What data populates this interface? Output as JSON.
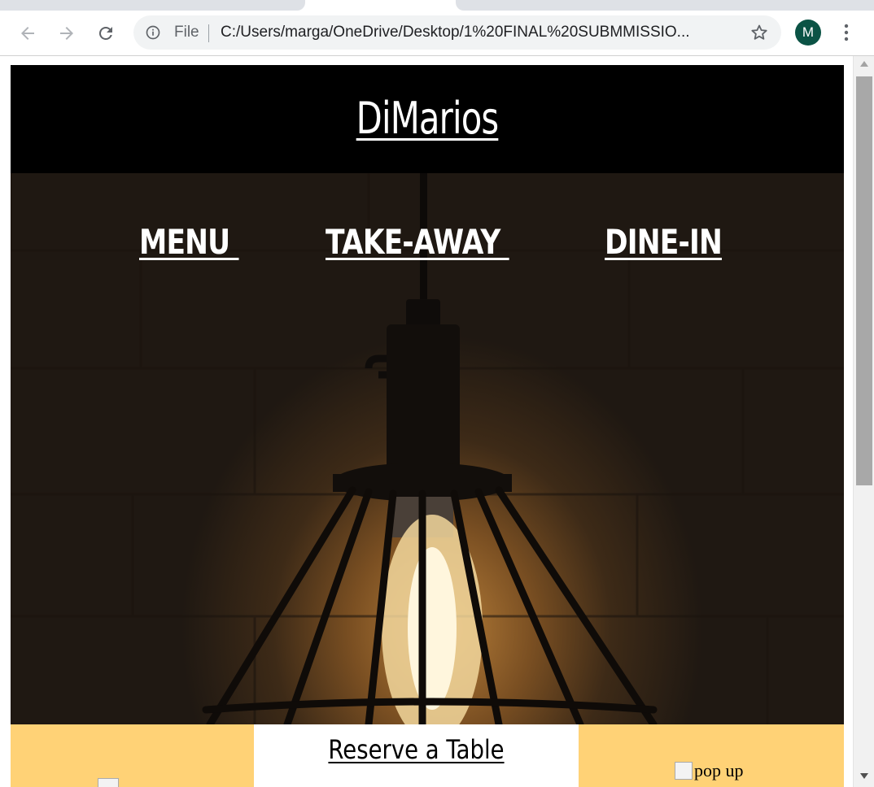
{
  "browser": {
    "file_label": "File",
    "url": "C:/Users/marga/OneDrive/Desktop/1%20FINAL%20SUBMMISSIO...",
    "profile_initial": "M",
    "colors": {
      "avatar": "#0b5345",
      "tabstrip": "#dee1e6",
      "omnibox": "#f1f3f4"
    }
  },
  "site": {
    "title": "DiMarios",
    "nav": [
      "MENU ",
      "TAKE-AWAY ",
      "DINE-IN"
    ],
    "reserve_label": "Reserve a Table",
    "popup_alt": "pop up",
    "colors": {
      "header": "#000000",
      "band": "#ffd276",
      "reserve_bg": "#ffffff"
    }
  },
  "icons": [
    "back-arrow-icon",
    "forward-arrow-icon",
    "reload-icon",
    "info-icon",
    "star-icon",
    "kebab-menu-icon"
  ]
}
